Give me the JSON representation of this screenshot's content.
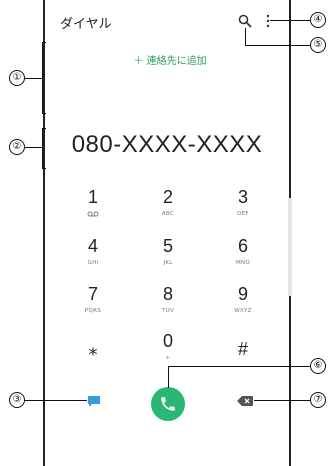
{
  "header": {
    "title": "ダイヤル"
  },
  "add_contact": {
    "label": "＋ 連絡先に追加"
  },
  "display": {
    "number": "080-XXXX-XXXX"
  },
  "keypad": [
    {
      "digit": "1",
      "sub": ""
    },
    {
      "digit": "2",
      "sub": "ABC"
    },
    {
      "digit": "3",
      "sub": "DEF"
    },
    {
      "digit": "4",
      "sub": "GHI"
    },
    {
      "digit": "5",
      "sub": "JKL"
    },
    {
      "digit": "6",
      "sub": "MNO"
    },
    {
      "digit": "7",
      "sub": "PQRS"
    },
    {
      "digit": "8",
      "sub": "TUV"
    },
    {
      "digit": "9",
      "sub": "WXYZ"
    },
    {
      "digit": "⁎",
      "sub": ""
    },
    {
      "digit": "0",
      "sub": "+"
    },
    {
      "digit": "#",
      "sub": ""
    }
  ],
  "icons": {
    "search": "search-icon",
    "more": "more-vertical-icon",
    "voicemail": "voicemail-icon",
    "message": "message-icon",
    "call": "phone-icon",
    "backspace": "backspace-icon"
  },
  "colors": {
    "accent_green": "#2bb673",
    "link_green": "#2e9e5e",
    "message_blue": "#3b9ad9",
    "icon_gray": "#555555"
  },
  "callouts": [
    "①",
    "②",
    "③",
    "④",
    "⑤",
    "⑥",
    "⑦"
  ]
}
